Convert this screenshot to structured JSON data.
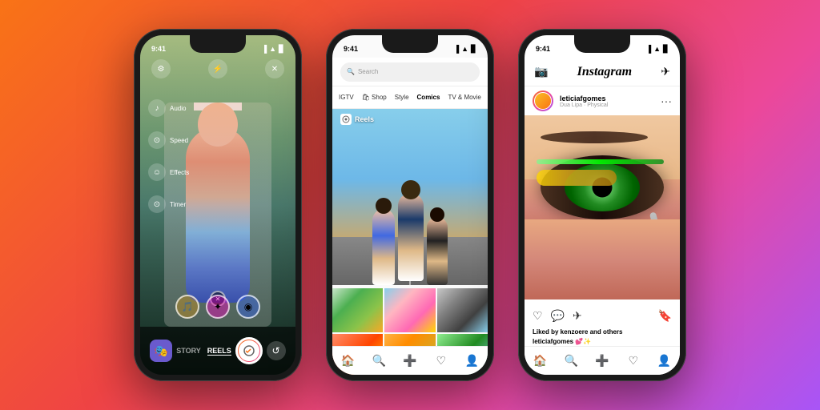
{
  "background": {
    "gradient": "linear-gradient(135deg, #f97316 0%, #ef4444 40%, #ec4899 70%, #a855f7 100%)"
  },
  "phones": {
    "phone1": {
      "status_time": "9:41",
      "mode": "REELS",
      "mode2": "STORY",
      "sidebar_items": [
        {
          "label": "Audio",
          "icon": "♪"
        },
        {
          "label": "Speed",
          "icon": "⊙"
        },
        {
          "label": "Effects",
          "icon": "☺"
        },
        {
          "label": "Timer",
          "icon": "⊙"
        }
      ]
    },
    "phone2": {
      "status_time": "9:41",
      "search_placeholder": "Search",
      "categories": [
        "IGTV",
        "Shop",
        "Style",
        "Comics",
        "TV & Movie"
      ],
      "reels_label": "Reels"
    },
    "phone3": {
      "status_time": "9:41",
      "logo": "Instagram",
      "username": "leticiafgomes",
      "subtitle": "Dua Lipa · Physical",
      "liked_by": "Liked by kenzoere and others",
      "caption_user": "leticiafgomes",
      "caption_text": "💕✨"
    }
  }
}
